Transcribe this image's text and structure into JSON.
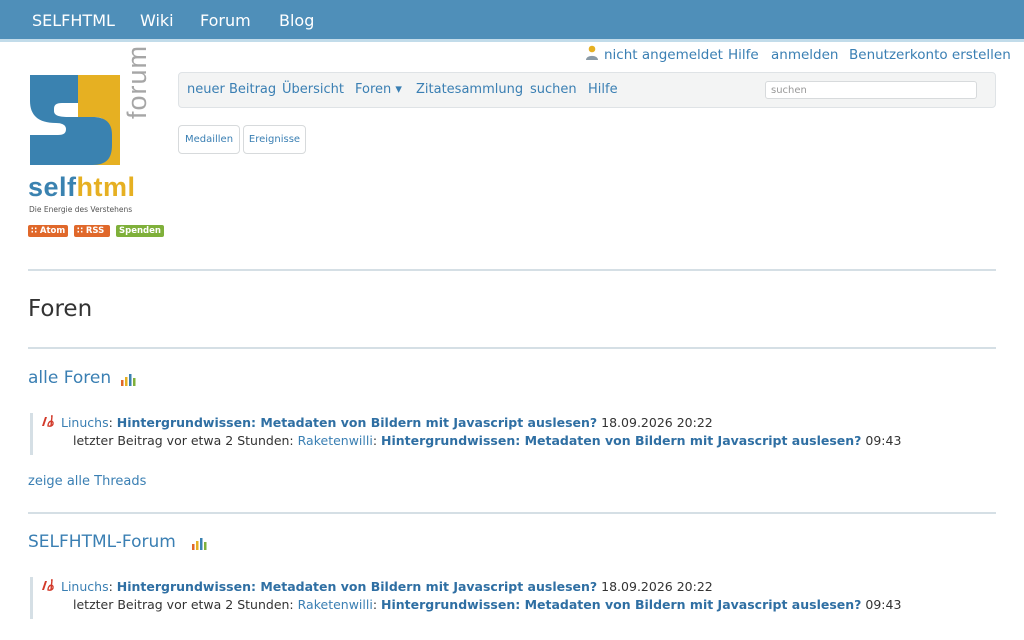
{
  "topnav": [
    "SELFHTML",
    "Wiki",
    "Forum",
    "Blog"
  ],
  "userbar": {
    "status": "nicht angemeldet",
    "help": "Hilfe",
    "login": "anmelden",
    "register": "Benutzerkonto erstellen"
  },
  "logo": {
    "wordmark_self": "self",
    "wordmark_html": "html",
    "side_text": "forum",
    "tagline": "Die Energie des Verstehens",
    "badges": [
      "Atom",
      "RSS",
      "Spenden"
    ]
  },
  "nav": {
    "items": [
      "neuer Beitrag",
      "Übersicht",
      "Foren ▾",
      "Zitatesammlung",
      "suchen",
      "Hilfe"
    ],
    "search_placeholder": "suchen"
  },
  "buttons": [
    "Medaillen",
    "Ereignisse"
  ],
  "page_title": "Foren",
  "forums": [
    {
      "title": "alle Foren",
      "thread": {
        "author": "Linuchs",
        "subject": "Hintergrundwissen: Metadaten von Bildern mit Javascript auslesen?",
        "date": "18.09.2026 20:22",
        "last_prefix": "letzter Beitrag vor etwa 2 Stunden:",
        "last_author": "Raketenwilli",
        "last_subject": "Hintergrundwissen: Metadaten von Bildern mit Javascript auslesen?",
        "last_time": "09:43"
      },
      "show_all": "zeige alle Threads"
    },
    {
      "title": "SELFHTML-Forum",
      "thread": {
        "author": "Linuchs",
        "subject": "Hintergrundwissen: Metadaten von Bildern mit Javascript auslesen?",
        "date": "18.09.2026 20:22",
        "last_prefix": "letzter Beitrag vor etwa 2 Stunden:",
        "last_author": "Raketenwilli",
        "last_subject": "Hintergrundwissen: Metadaten von Bildern mit Javascript auslesen?",
        "last_time": "09:43"
      }
    }
  ],
  "colors": {
    "topbar": "#4f8fb9",
    "link": "#3a7fb3",
    "logo_blue": "#3a82b0",
    "logo_yellow": "#e6b022",
    "badge_orange": "#e0682a",
    "badge_green": "#7fb03a"
  },
  "icons": [
    "user-icon",
    "rss-icon",
    "stats-icon",
    "pen-icon"
  ]
}
